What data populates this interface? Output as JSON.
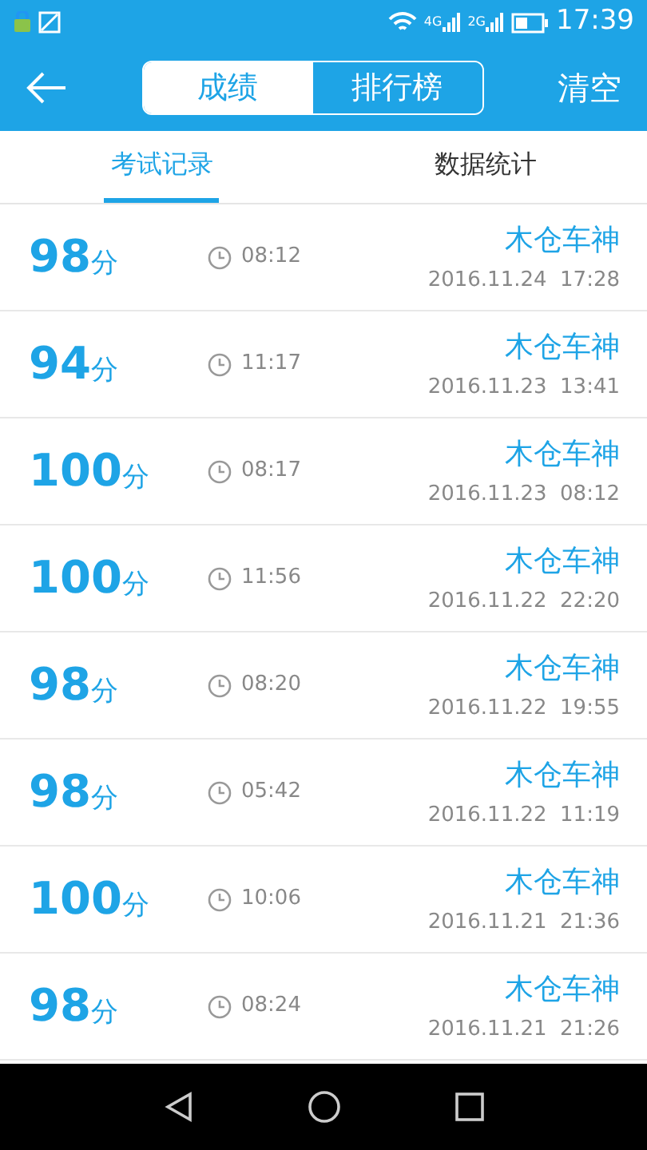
{
  "status_bar": {
    "network_labels": [
      "4G",
      "2G"
    ],
    "time": "17:39"
  },
  "header": {
    "segments": [
      {
        "label": "成绩",
        "selected": true
      },
      {
        "label": "排行榜",
        "selected": false
      }
    ],
    "action": "清空"
  },
  "tabs": [
    {
      "label": "考试记录",
      "selected": true
    },
    {
      "label": "数据统计",
      "selected": false
    }
  ],
  "records": [
    {
      "score": "98",
      "unit": "分",
      "duration": "08:12",
      "name": "木仓车神",
      "datetime": "2016.11.24  17:28"
    },
    {
      "score": "94",
      "unit": "分",
      "duration": "11:17",
      "name": "木仓车神",
      "datetime": "2016.11.23  13:41"
    },
    {
      "score": "100",
      "unit": "分",
      "duration": "08:17",
      "name": "木仓车神",
      "datetime": "2016.11.23  08:12"
    },
    {
      "score": "100",
      "unit": "分",
      "duration": "11:56",
      "name": "木仓车神",
      "datetime": "2016.11.22  22:20"
    },
    {
      "score": "98",
      "unit": "分",
      "duration": "08:20",
      "name": "木仓车神",
      "datetime": "2016.11.22  19:55"
    },
    {
      "score": "98",
      "unit": "分",
      "duration": "05:42",
      "name": "木仓车神",
      "datetime": "2016.11.22  11:19"
    },
    {
      "score": "100",
      "unit": "分",
      "duration": "10:06",
      "name": "木仓车神",
      "datetime": "2016.11.21  21:36"
    },
    {
      "score": "98",
      "unit": "分",
      "duration": "08:24",
      "name": "木仓车神",
      "datetime": "2016.11.21  21:26"
    }
  ]
}
